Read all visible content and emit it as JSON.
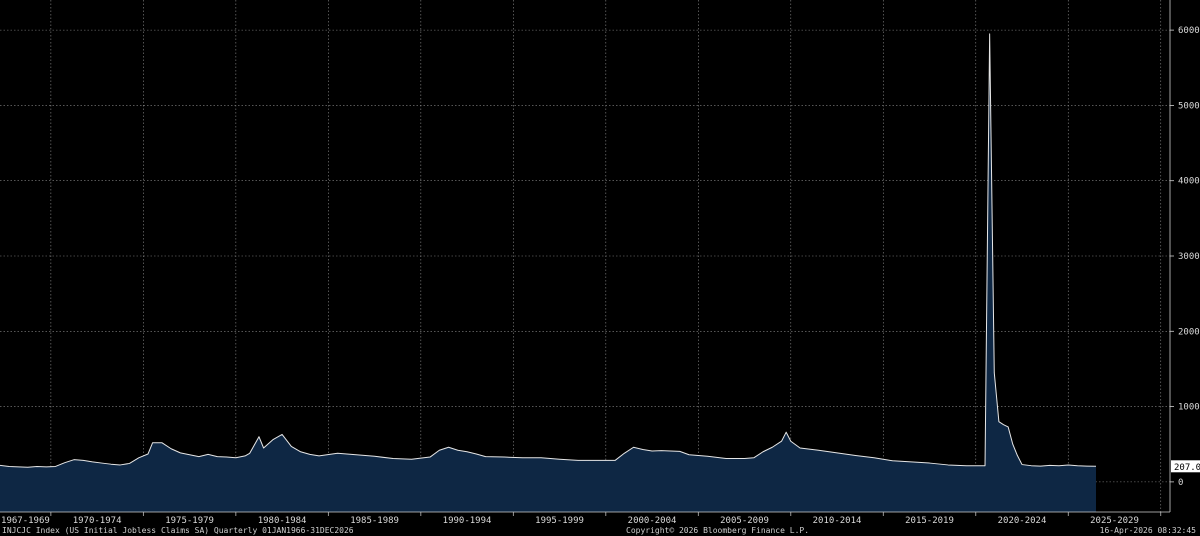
{
  "footer": {
    "left": "INJCJC Index (US Initial Jobless Claims SA) Quarterly 01JAN1966-31DEC2026",
    "center": "Copyright© 2026 Bloomberg Finance L.P.",
    "right": "16-Apr-2026 08:32:45"
  },
  "colors": {
    "background": "#000000",
    "area_fill": "#0e2744",
    "line": "#e6e6e6",
    "grid": "#8a8a8a",
    "last_value_box": "#ffffff"
  },
  "chart_data": {
    "type": "area",
    "title": "",
    "xlabel": "",
    "ylabel": "",
    "grid": true,
    "xlim": [
      1966.75,
      2030.0
    ],
    "ylim": [
      -400,
      6400
    ],
    "y_ticks": [
      0,
      1000,
      2000,
      3000,
      4000,
      5000,
      6000
    ],
    "x_tick_labels": [
      "1967-1969",
      "1970-1974",
      "1975-1979",
      "1980-1984",
      "1985-1989",
      "1990-1994",
      "1995-1999",
      "2000-2004",
      "2005-2009",
      "2010-2014",
      "2015-2019",
      "2020-2024",
      "2025-2029"
    ],
    "last_value_label": "207.0",
    "series": [
      {
        "x": [
          1966.75,
          1967.25,
          1967.75,
          1968.25,
          1968.75,
          1969.25,
          1969.75,
          1970.25,
          1970.75,
          1971.25,
          1971.75,
          1972.25,
          1972.75,
          1973.25,
          1973.75,
          1974.25,
          1974.75,
          1975.0,
          1975.5,
          1976.0,
          1976.5,
          1977.0,
          1977.5,
          1978.0,
          1978.5,
          1979.0,
          1979.5,
          1980.0,
          1980.25,
          1980.5,
          1980.75,
          1981.0,
          1981.5,
          1982.0,
          1982.5,
          1983.0,
          1983.5,
          1984.0,
          1985.0,
          1986.0,
          1987.0,
          1988.0,
          1989.0,
          1990.0,
          1990.5,
          1991.0,
          1991.5,
          1992.0,
          1992.5,
          1993.0,
          1994.0,
          1995.0,
          1996.0,
          1997.0,
          1998.0,
          1999.0,
          2000.0,
          2000.5,
          2001.0,
          2001.5,
          2002.0,
          2002.5,
          2003.0,
          2003.5,
          2004.0,
          2005.0,
          2006.0,
          2007.0,
          2007.5,
          2008.0,
          2008.5,
          2009.0,
          2009.25,
          2009.5,
          2010.0,
          2011.0,
          2012.0,
          2013.0,
          2014.0,
          2015.0,
          2016.0,
          2017.0,
          2018.0,
          2019.0,
          2019.5,
          2019.75,
          2020.0,
          2020.25,
          2020.5,
          2020.75,
          2021.0,
          2021.25,
          2021.5,
          2021.75,
          2022.0,
          2022.5,
          2023.0,
          2023.5,
          2024.0,
          2024.5,
          2025.0,
          2025.5,
          2026.0
        ],
        "y": [
          220,
          205,
          200,
          195,
          205,
          200,
          205,
          255,
          295,
          285,
          265,
          250,
          235,
          225,
          245,
          320,
          370,
          520,
          520,
          440,
          385,
          360,
          335,
          365,
          335,
          330,
          320,
          345,
          380,
          490,
          600,
          450,
          560,
          630,
          470,
          400,
          365,
          345,
          380,
          360,
          340,
          310,
          300,
          330,
          420,
          460,
          420,
          400,
          370,
          335,
          330,
          320,
          320,
          300,
          285,
          285,
          285,
          380,
          460,
          430,
          410,
          415,
          410,
          405,
          360,
          340,
          310,
          310,
          320,
          400,
          460,
          540,
          660,
          540,
          450,
          420,
          385,
          350,
          320,
          280,
          265,
          250,
          225,
          215,
          215,
          215,
          215,
          5950,
          1450,
          800,
          760,
          730,
          500,
          350,
          230,
          215,
          210,
          220,
          215,
          225,
          215,
          210,
          207
        ]
      }
    ]
  }
}
